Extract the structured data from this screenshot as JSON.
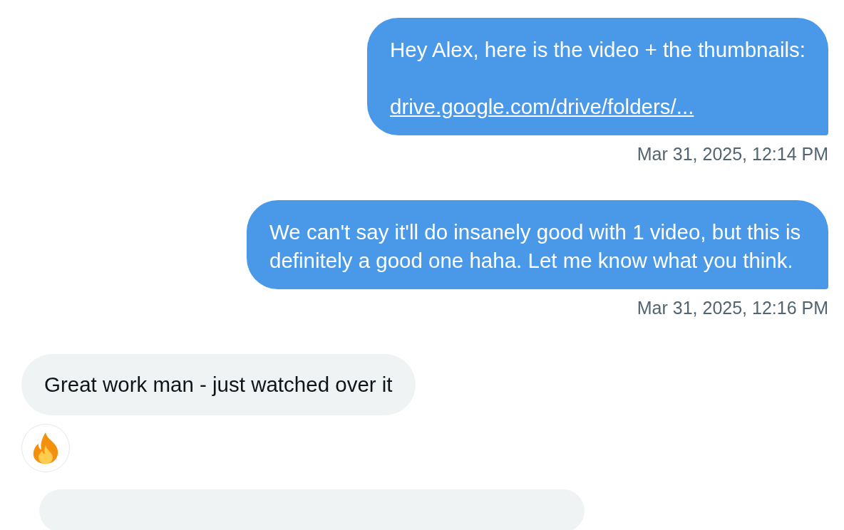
{
  "messages": [
    {
      "kind": "sent",
      "paragraphs": [
        {
          "kind": "text",
          "text": "Hey Alex, here is the video + the thumbnails:"
        },
        {
          "kind": "link",
          "text": "drive.google.com/drive/folders/..."
        }
      ],
      "timestamp": "Mar 31, 2025, 12:14 PM",
      "reaction": false
    },
    {
      "kind": "sent",
      "paragraphs": [
        {
          "kind": "text",
          "text": "We can't say it'll do insanely good with 1 video, but this is definitely a good one haha. Let me know what you think."
        }
      ],
      "timestamp": "Mar 31, 2025, 12:16 PM",
      "reaction": false
    },
    {
      "kind": "received",
      "paragraphs": [
        {
          "kind": "text",
          "text": "Great work man - just watched over it"
        }
      ],
      "reaction": true
    }
  ]
}
